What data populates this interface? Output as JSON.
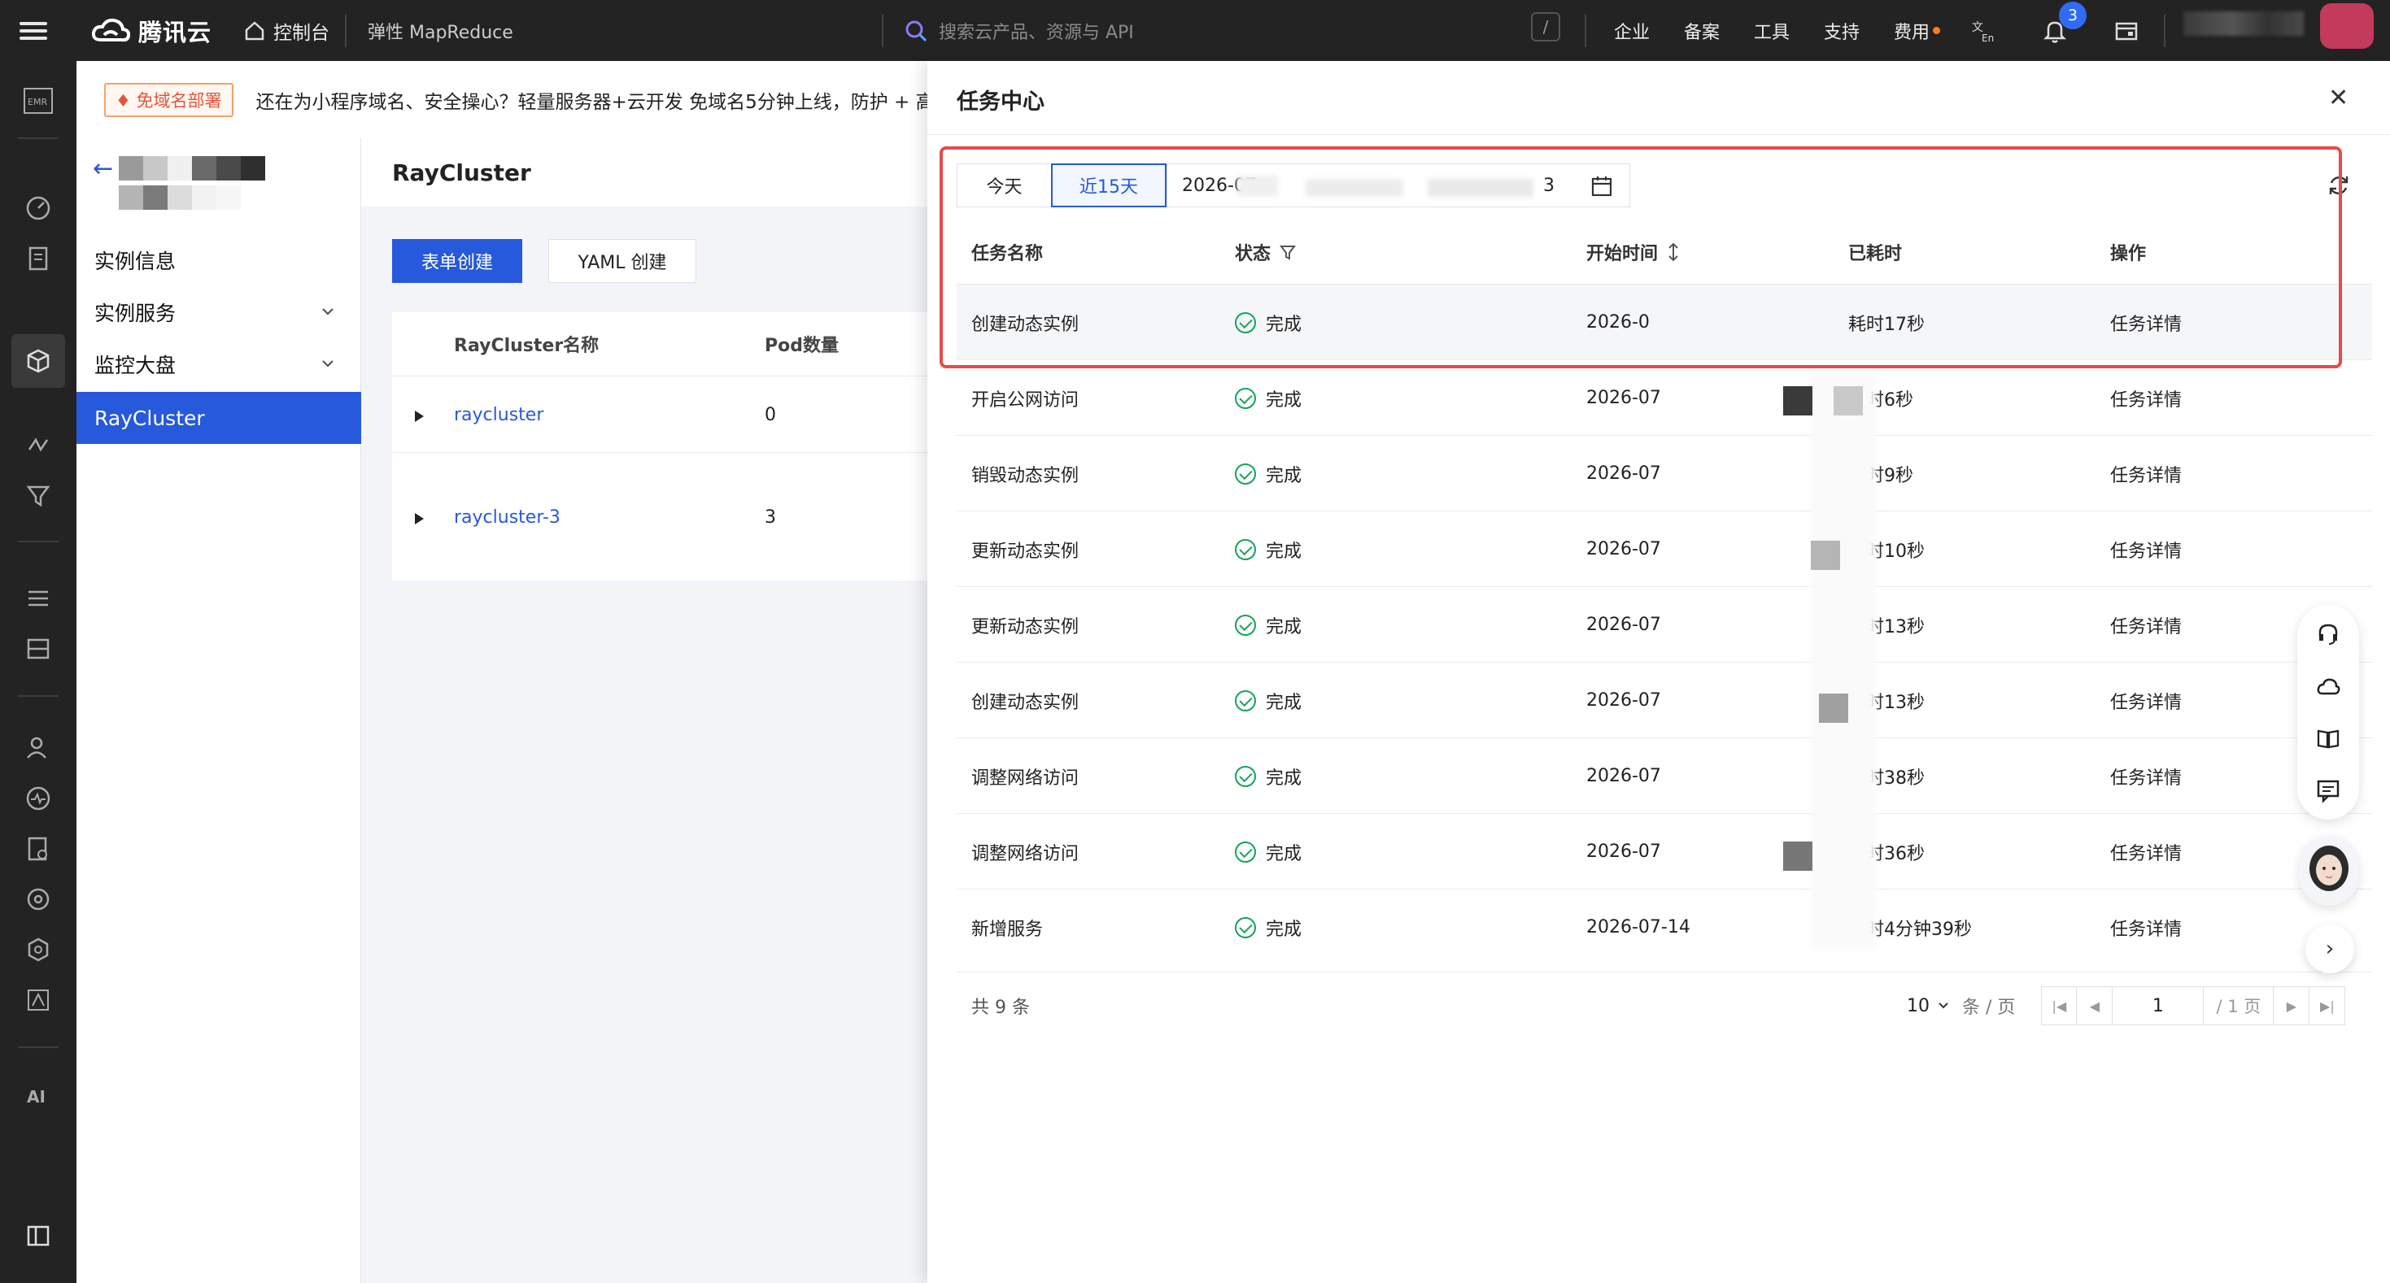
{
  "topbar": {
    "brand": "腾讯云",
    "console": "控制台",
    "product": "弹性 MapReduce",
    "search_placeholder": "搜索云产品、资源与 API",
    "search_shortcut": "/",
    "nav": [
      "企业",
      "备案",
      "工具",
      "支持",
      "费用"
    ],
    "notification_count": "3"
  },
  "notice": {
    "tag": "免域名部署",
    "message": "还在为小程序域名、安全操心？轻量服务器+云开发 免域名5分钟上线，防护 + 高性能 +"
  },
  "sidebar": {
    "items": [
      {
        "label": "实例信息"
      },
      {
        "label": "实例服务"
      },
      {
        "label": "监控大盘"
      },
      {
        "label": "RayCluster"
      }
    ]
  },
  "main": {
    "title": "RayCluster",
    "create_form": "表单创建",
    "create_yaml": "YAML 创建",
    "columns": [
      "RayCluster名称",
      "Pod数量"
    ],
    "rows": [
      {
        "name": "raycluster",
        "pods": "0"
      },
      {
        "name": "raycluster-3",
        "pods": "3"
      }
    ]
  },
  "task_center": {
    "title": "任务中心",
    "ranges": [
      "今天",
      "近15天"
    ],
    "date_start": "2026-07",
    "date_end": "3",
    "columns": [
      "任务名称",
      "状态",
      "开始时间",
      "已耗时",
      "操作"
    ],
    "rows": [
      {
        "name": "创建动态实例",
        "status": "完成",
        "start": "2026-0",
        "elapsed": "耗时17秒",
        "action": "任务详情"
      },
      {
        "name": "开启公网访问",
        "status": "完成",
        "start": "2026-07",
        "elapsed": "耗时6秒",
        "action": "任务详情"
      },
      {
        "name": "销毁动态实例",
        "status": "完成",
        "start": "2026-07",
        "elapsed": "耗时9秒",
        "action": "任务详情"
      },
      {
        "name": "更新动态实例",
        "status": "完成",
        "start": "2026-07",
        "elapsed": "耗时10秒",
        "action": "任务详情"
      },
      {
        "name": "更新动态实例",
        "status": "完成",
        "start": "2026-07",
        "elapsed": "耗时13秒",
        "action": "任务详情"
      },
      {
        "name": "创建动态实例",
        "status": "完成",
        "start": "2026-07",
        "elapsed": "耗时13秒",
        "action": "任务详情"
      },
      {
        "name": "调整网络访问",
        "status": "完成",
        "start": "2026-07",
        "elapsed": "耗时38秒",
        "action": "任务详情"
      },
      {
        "name": "调整网络访问",
        "status": "完成",
        "start": "2026-07",
        "elapsed": "耗时36秒",
        "action": "任务详情"
      },
      {
        "name": "新增服务",
        "status": "完成",
        "start": "2026-07-14",
        "elapsed": "耗时4分钟39秒",
        "action": "任务详情"
      }
    ],
    "total": "共 9 条",
    "page_size": "10",
    "page_size_unit": "条 / 页",
    "page": "1",
    "page_total": "/ 1 页"
  },
  "colors": {
    "primary": "#2659db",
    "success": "#14a35b",
    "highlight_box": "#e64b4b",
    "topbar": "#232323"
  }
}
